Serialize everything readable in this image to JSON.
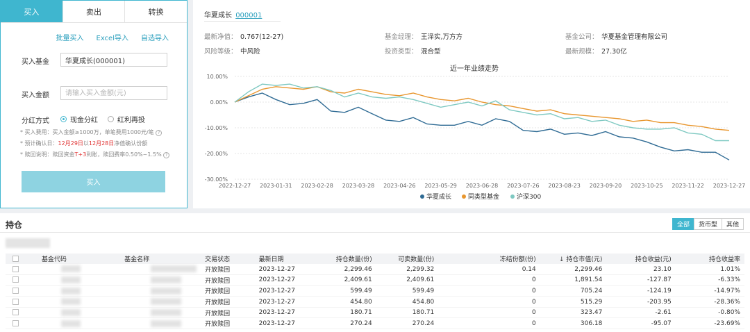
{
  "trade": {
    "tabs": [
      "买入",
      "卖出",
      "转换"
    ],
    "links": [
      "批量买入",
      "Excel导入",
      "自选导入"
    ],
    "fund_label": "买入基金",
    "fund_value": "华夏成长(000001)",
    "amount_label": "买入金额",
    "amount_placeholder": "请输入买入金额(元)",
    "dividend_label": "分红方式",
    "dividend_options": [
      "现金分红",
      "红利再投"
    ],
    "note1": "* 买入费用：买入金额≥1000万，单笔费用1000元/笔",
    "note2_pre": "* 预计确认日：",
    "note2_d1": "12月29日",
    "note2_mid": "以",
    "note2_d2": "12月28日",
    "note2_post": "净值确认份额",
    "note3_pre": "* 赎回说明：赎回资金",
    "note3_t": "T+3",
    "note3_post": "到账，赎回费率0.50%~1.5%",
    "buy_button": "买入",
    "accent": "#3fb6cf"
  },
  "fund": {
    "name": "华夏成长",
    "code": "000001",
    "nav_label": "最新净值：",
    "nav_value": "0.767(12-27)",
    "manager_label": "基金经理：",
    "manager_value": "王泽实,万方方",
    "company_label": "基金公司：",
    "company_value": "华夏基金管理有限公司",
    "risk_label": "风险等级：",
    "risk_value": "中风险",
    "type_label": "投资类型：",
    "type_value": "混合型",
    "scale_label": "最新规模：",
    "scale_value": "27.30亿"
  },
  "chart_data": {
    "type": "line",
    "title": "近一年业绩走势",
    "xlabel": "",
    "ylabel": "",
    "ylim": [
      -30,
      10
    ],
    "y_ticks": [
      "10.00%",
      "0.00%",
      "-10.00%",
      "-20.00%",
      "-30.00%"
    ],
    "x_ticks": [
      "2022-12-27",
      "2023-01-31",
      "2023-02-28",
      "2023-03-28",
      "2023-04-26",
      "2023-05-29",
      "2023-06-28",
      "2023-07-26",
      "2023-08-23",
      "2023-09-20",
      "2023-10-25",
      "2023-11-22",
      "2023-12-27"
    ],
    "grid": true,
    "legend": "bottom",
    "series": [
      {
        "name": "华夏成长",
        "color": "#2f6b94",
        "values": [
          0,
          2.0,
          3.5,
          1.0,
          -1.0,
          -0.5,
          1.0,
          -3.5,
          -4.0,
          -2.0,
          -4.5,
          -7.0,
          -7.5,
          -6.0,
          -8.5,
          -9.0,
          -9.0,
          -7.5,
          -9.0,
          -6.5,
          -7.5,
          -11.0,
          -11.5,
          -10.5,
          -12.5,
          -12.0,
          -13.0,
          -11.5,
          -13.5,
          -14.0,
          -15.5,
          -17.5,
          -19.0,
          -18.5,
          -19.5,
          -19.5,
          -22.5
        ]
      },
      {
        "name": "同类型基金",
        "color": "#e8962e",
        "values": [
          0,
          2.5,
          5.0,
          6.0,
          5.5,
          5.0,
          6.0,
          4.0,
          3.5,
          5.0,
          4.0,
          3.0,
          2.5,
          3.5,
          2.0,
          1.0,
          0.5,
          1.5,
          0.0,
          -1.0,
          -1.5,
          -2.5,
          -3.5,
          -3.0,
          -4.5,
          -5.0,
          -5.5,
          -6.0,
          -6.5,
          -7.5,
          -7.0,
          -8.0,
          -8.0,
          -9.0,
          -9.5,
          -10.5,
          -11.0
        ]
      },
      {
        "name": "沪深300",
        "color": "#7fc9c2",
        "values": [
          0,
          4.0,
          7.0,
          6.5,
          7.0,
          5.5,
          6.0,
          4.5,
          2.0,
          3.5,
          2.0,
          1.5,
          2.0,
          1.0,
          -0.5,
          -2.0,
          -1.0,
          0.0,
          -1.5,
          0.5,
          -3.0,
          -4.0,
          -5.0,
          -4.5,
          -6.5,
          -6.0,
          -7.5,
          -7.0,
          -9.0,
          -10.0,
          -10.5,
          -10.5,
          -10.0,
          -12.0,
          -12.5,
          -15.0,
          -15.0
        ]
      }
    ]
  },
  "holdings": {
    "title": "持仓",
    "filters": [
      "全部",
      "货币型",
      "其他"
    ],
    "columns": [
      "基金代码",
      "基金名称",
      "交易状态",
      "最新日期",
      "持仓数量(份)",
      "可卖数量(份)",
      "冻结份额(份)",
      "↓ 持仓市值(元)",
      "持仓收益(元)",
      "持仓收益率"
    ],
    "rows": [
      {
        "status": "开放赎回",
        "date": "2023-12-27",
        "qty": "2,299.46",
        "sell": "2,299.32",
        "frozen": "0.14",
        "value": "2,299.46",
        "profit": "23.10",
        "rate": "1.01%"
      },
      {
        "status": "开放赎回",
        "date": "2023-12-27",
        "qty": "2,409.61",
        "sell": "2,409.61",
        "frozen": "0",
        "value": "1,891.54",
        "profit": "-127.87",
        "rate": "-6.33%"
      },
      {
        "status": "开放赎回",
        "date": "2023-12-27",
        "qty": "599.49",
        "sell": "599.49",
        "frozen": "0",
        "value": "705.24",
        "profit": "-124.19",
        "rate": "-14.97%"
      },
      {
        "status": "开放赎回",
        "date": "2023-12-27",
        "qty": "454.80",
        "sell": "454.80",
        "frozen": "0",
        "value": "515.29",
        "profit": "-203.95",
        "rate": "-28.36%"
      },
      {
        "status": "开放赎回",
        "date": "2023-12-27",
        "qty": "180.71",
        "sell": "180.71",
        "frozen": "0",
        "value": "323.47",
        "profit": "-2.61",
        "rate": "-0.80%"
      },
      {
        "status": "开放赎回",
        "date": "2023-12-27",
        "qty": "270.24",
        "sell": "270.24",
        "frozen": "0",
        "value": "306.18",
        "profit": "-95.07",
        "rate": "-23.69%"
      }
    ]
  }
}
